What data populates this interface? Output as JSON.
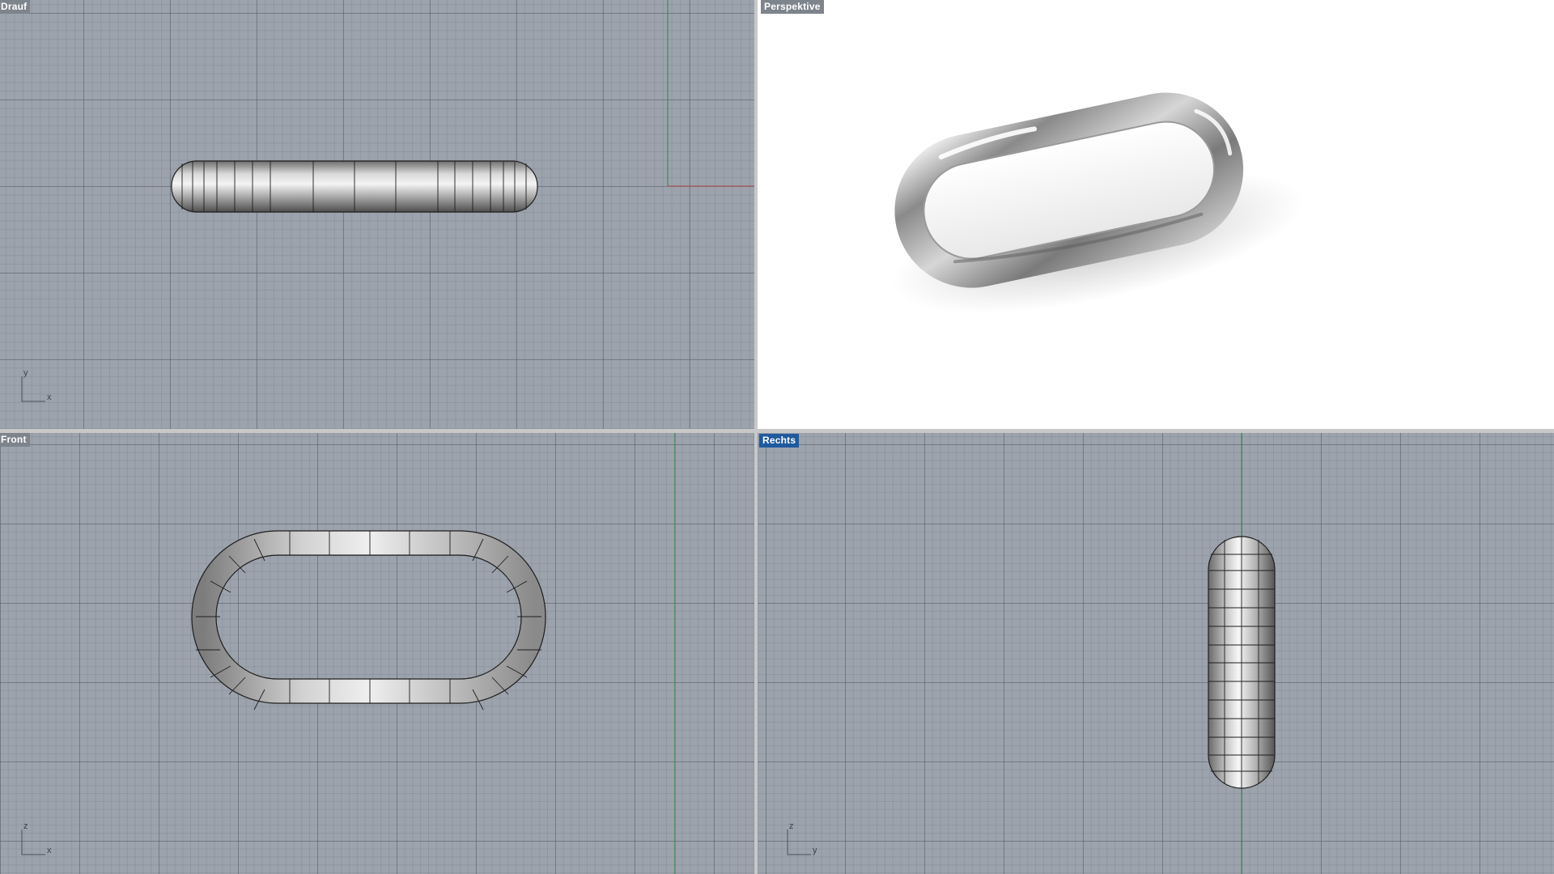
{
  "viewports": {
    "top": {
      "label": "Drauf",
      "axes": {
        "vertical": "y",
        "horizontal": "x"
      }
    },
    "persp": {
      "label": "Perspektive"
    },
    "front": {
      "label": "Front",
      "axes": {
        "vertical": "z",
        "horizontal": "x"
      }
    },
    "right": {
      "label": "Rechts",
      "axes": {
        "vertical": "z",
        "horizontal": "y"
      },
      "active": true
    }
  },
  "colors": {
    "viewport_bg": "#9ca3ad",
    "grid_line": "#5a6170",
    "x_axis": "#b24a4a",
    "y_axis": "#2e8b3e",
    "active_label": "#1f5a9e",
    "object_wire": "#1e1e1e"
  },
  "object": {
    "name": "stadium-ring"
  }
}
